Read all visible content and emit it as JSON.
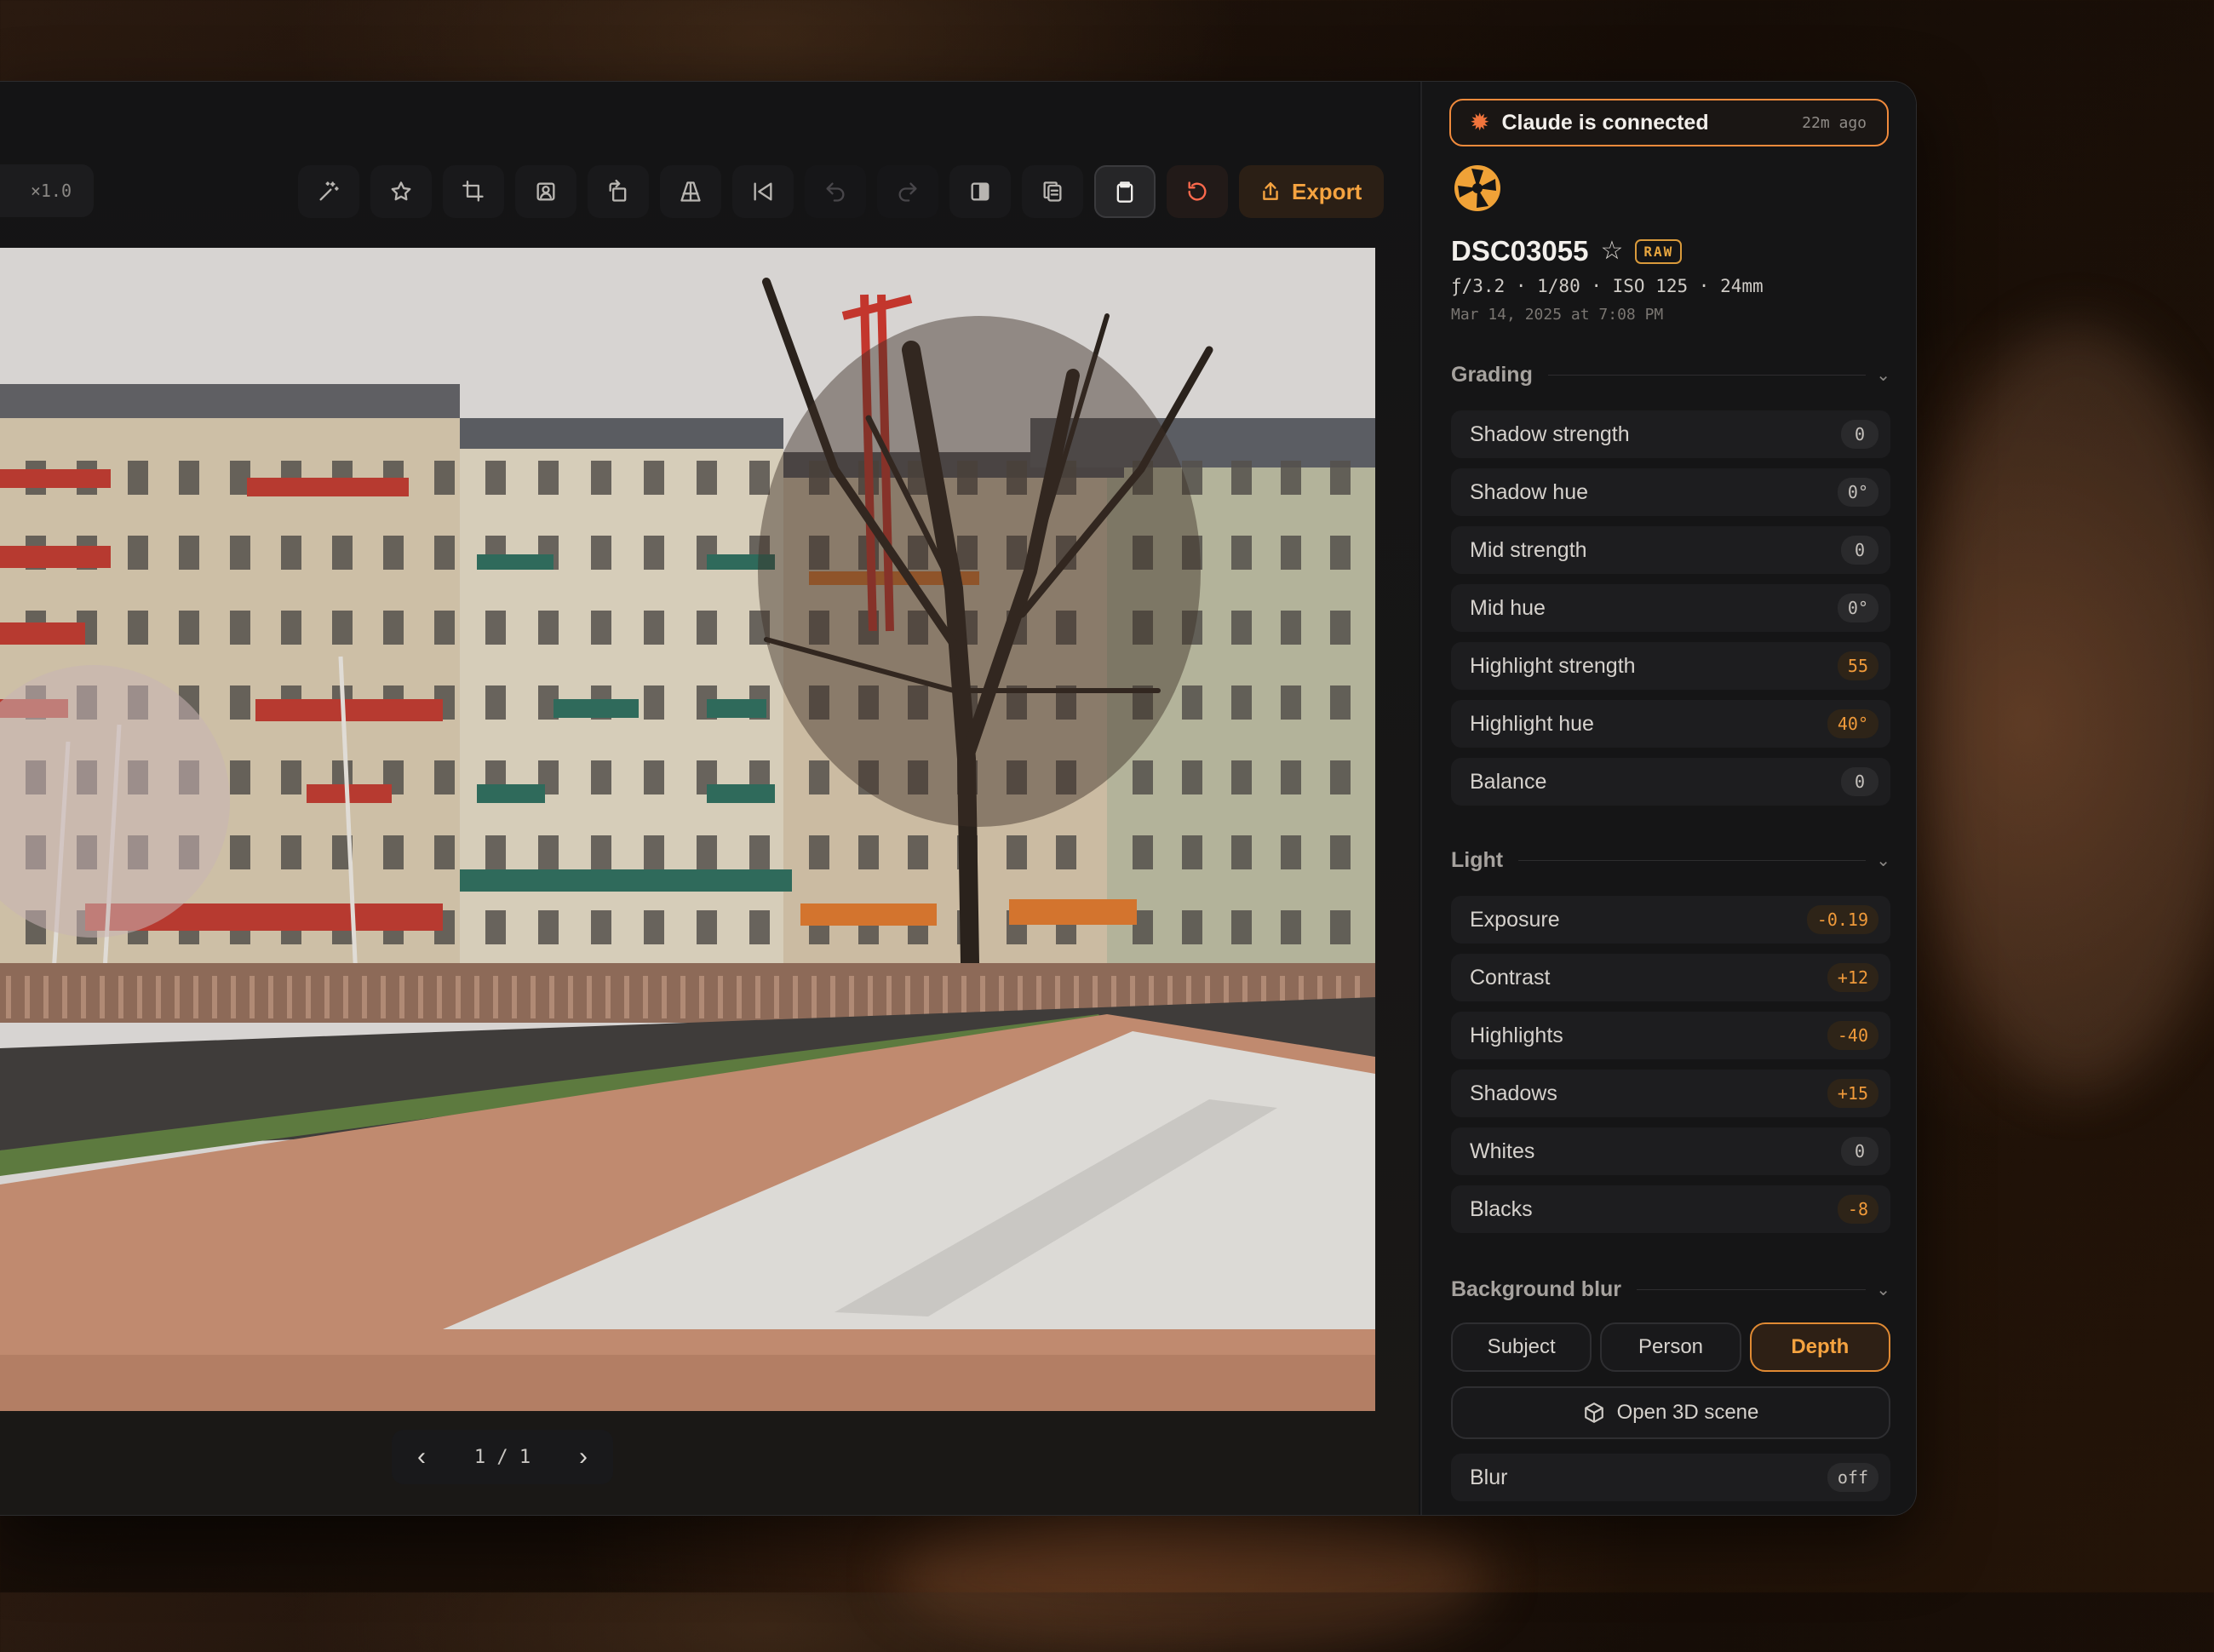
{
  "viewer": {
    "zoom_label": "×1.0",
    "pager_text": "1 / 1",
    "photo_alt": "Hotel buildings with bare tree and fountain basin"
  },
  "toolbar": {
    "tools": [
      {
        "name": "magic-wand-icon",
        "state": "normal"
      },
      {
        "name": "star-icon",
        "state": "normal"
      },
      {
        "name": "crop-icon",
        "state": "normal"
      },
      {
        "name": "portrait-icon",
        "state": "normal"
      },
      {
        "name": "rotate-icon",
        "state": "normal"
      },
      {
        "name": "perspective-icon",
        "state": "normal"
      },
      {
        "name": "flip-icon",
        "state": "normal"
      },
      {
        "name": "undo-icon",
        "state": "disabled"
      },
      {
        "name": "redo-icon",
        "state": "disabled"
      },
      {
        "name": "compare-icon",
        "state": "normal"
      },
      {
        "name": "copy-icon",
        "state": "normal"
      },
      {
        "name": "clipboard-icon",
        "state": "active"
      },
      {
        "name": "reset-icon",
        "state": "warning"
      }
    ],
    "export_label": "Export"
  },
  "status": {
    "title": "Claude is connected",
    "ago": "22m ago"
  },
  "photo_meta": {
    "filename": "DSC03055",
    "badge": "RAW",
    "exif": "ƒ/3.2 · 1/80 · ISO 125 · 24mm",
    "date": "Mar 14, 2025 at 7:08 PM"
  },
  "grading": {
    "title": "Grading",
    "rows": [
      {
        "label": "Shadow strength",
        "value": "0",
        "accent": false
      },
      {
        "label": "Shadow hue",
        "value": "0°",
        "accent": false
      },
      {
        "label": "Mid strength",
        "value": "0",
        "accent": false
      },
      {
        "label": "Mid hue",
        "value": "0°",
        "accent": false
      },
      {
        "label": "Highlight strength",
        "value": "55",
        "accent": true
      },
      {
        "label": "Highlight hue",
        "value": "40°",
        "accent": true
      },
      {
        "label": "Balance",
        "value": "0",
        "accent": false
      }
    ]
  },
  "light": {
    "title": "Light",
    "rows": [
      {
        "label": "Exposure",
        "value": "-0.19",
        "accent": true
      },
      {
        "label": "Contrast",
        "value": "+12",
        "accent": true
      },
      {
        "label": "Highlights",
        "value": "-40",
        "accent": true
      },
      {
        "label": "Shadows",
        "value": "+15",
        "accent": true
      },
      {
        "label": "Whites",
        "value": "0",
        "accent": false
      },
      {
        "label": "Blacks",
        "value": "-8",
        "accent": true
      }
    ]
  },
  "background_blur": {
    "title": "Background blur",
    "modes": [
      "Subject",
      "Person",
      "Depth"
    ],
    "selected": "Depth",
    "open3d_label": "Open 3D scene",
    "blur_label": "Blur",
    "blur_value": "off"
  },
  "colors": {
    "accent": "#f5a340",
    "connected_border": "#f08a3c",
    "reset": "#ff6a4d"
  }
}
